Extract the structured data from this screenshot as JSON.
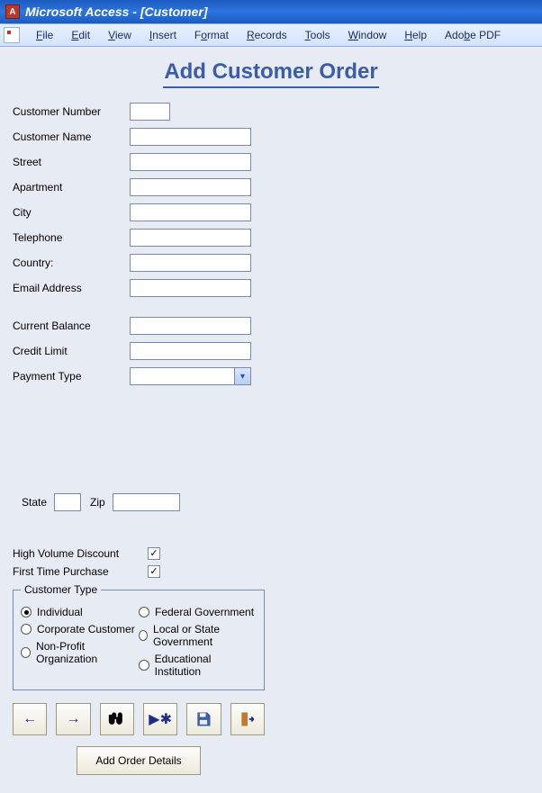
{
  "window": {
    "title": "Microsoft Access - [Customer]"
  },
  "menu": {
    "file": "File",
    "edit": "Edit",
    "view": "View",
    "insert": "Insert",
    "format": "Format",
    "records": "Records",
    "tools": "Tools",
    "window": "Window",
    "help": "Help",
    "adobe": "Adobe PDF"
  },
  "form": {
    "title": "Add Customer Order",
    "labels": {
      "customer_number": "Customer Number",
      "customer_name": "Customer Name",
      "street": "Street",
      "apartment": "Apartment",
      "city": "City",
      "state": "State",
      "zip": "Zip",
      "telephone": "Telephone",
      "country": "Country:",
      "email": "Email Address",
      "current_balance": "Current Balance",
      "credit_limit": "Credit Limit",
      "payment_type": "Payment Type",
      "high_volume": "High Volume Discount",
      "first_time": "First Time Purchase",
      "customer_type": "Customer Type"
    },
    "values": {
      "customer_number": "",
      "customer_name": "",
      "street": "",
      "apartment": "",
      "city": "",
      "state": "",
      "zip": "",
      "telephone": "",
      "country": "",
      "email": "",
      "current_balance": "",
      "credit_limit": "",
      "payment_type": "",
      "high_volume_checked": true,
      "first_time_checked": true,
      "customer_type_selected": "individual"
    },
    "customer_type_options": {
      "individual": "Individual",
      "corporate": "Corporate Customer",
      "nonprofit": "Non-Profit Organization",
      "federal": "Federal Government",
      "local": "Local or State Government",
      "educational": "Educational Institution"
    },
    "buttons": {
      "add_order_details": "Add Order Details"
    }
  }
}
